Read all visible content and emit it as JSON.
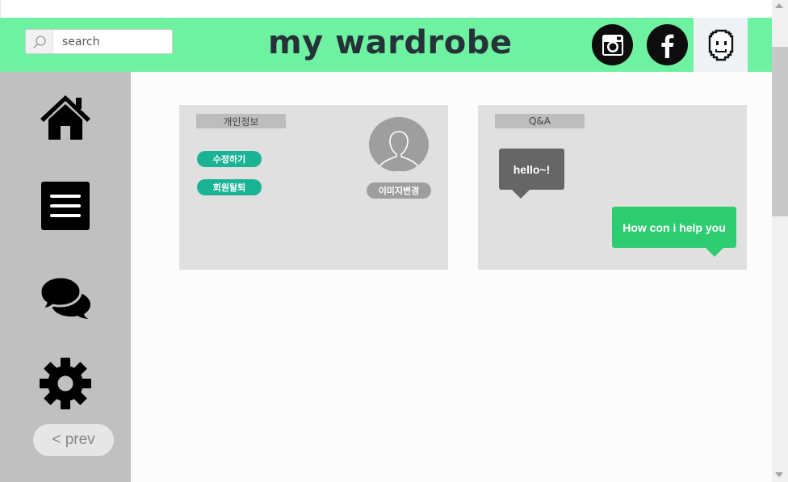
{
  "header": {
    "brand": "my wardrobe",
    "search": {
      "placeholder": "search",
      "icon": "search-icon"
    },
    "social": [
      {
        "name": "instagram",
        "icon": "instagram-icon"
      },
      {
        "name": "facebook",
        "icon": "facebook-icon"
      }
    ],
    "avatar_icon": "pixel-face-icon",
    "accent_color": "#6ef2a2"
  },
  "sidebar": {
    "items": [
      {
        "icon": "home-icon"
      },
      {
        "icon": "menu-icon"
      },
      {
        "icon": "chat-bubbles-icon"
      },
      {
        "icon": "gear-icon"
      }
    ],
    "prev_label": "< prev",
    "background": "#c0c0c0"
  },
  "profile_card": {
    "tab_label": "개인정보",
    "edit_label": "수정하기",
    "withdraw_label": "회원탈퇴",
    "change_image_label": "이미지변경",
    "pill_color": "#1ab394"
  },
  "qa_card": {
    "tab_label": "Q&A",
    "incoming_message": "hello~!",
    "outgoing_message": "How con i help you",
    "incoming_color": "#666666",
    "outgoing_color": "#2ecc71"
  }
}
